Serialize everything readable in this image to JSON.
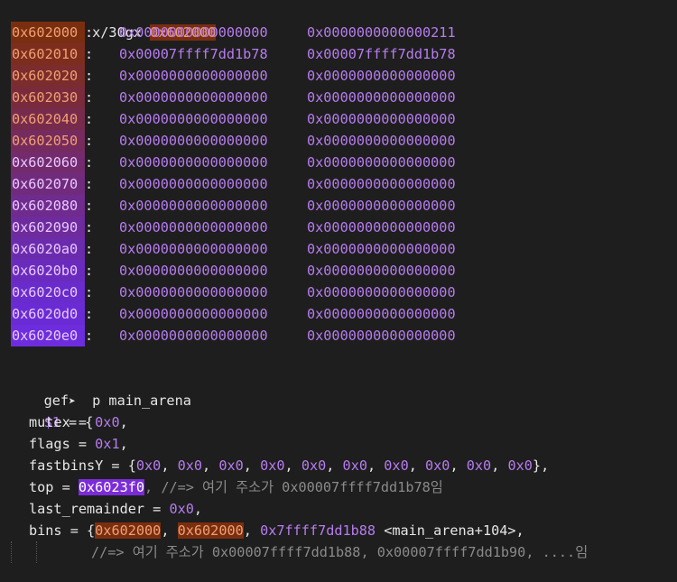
{
  "prompt": {
    "name": "gef",
    "arrow": "➤",
    "cmd1": "x/30gx ",
    "cmd1_arg": "0x602000",
    "cmd2": "p main_arena"
  },
  "memory_rows": [
    {
      "addr": "0x602000",
      "v1": "0x0000000000000000",
      "v2": "0x0000000000000211",
      "color": "#7a2e10"
    },
    {
      "addr": "0x602010",
      "v1": "0x00007ffff7dd1b78",
      "v2": "0x00007ffff7dd1b78",
      "color": "#7c2d1e"
    },
    {
      "addr": "0x602020",
      "v1": "0x0000000000000000",
      "v2": "0x0000000000000000",
      "color": "#7b2c2c"
    },
    {
      "addr": "0x602030",
      "v1": "0x0000000000000000",
      "v2": "0x0000000000000000",
      "color": "#792b3c"
    },
    {
      "addr": "0x602040",
      "v1": "0x0000000000000000",
      "v2": "0x0000000000000000",
      "color": "#772b4c"
    },
    {
      "addr": "0x602050",
      "v1": "0x0000000000000000",
      "v2": "0x0000000000000000",
      "color": "#752b5d"
    },
    {
      "addr": "0x602060",
      "v1": "0x0000000000000000",
      "v2": "0x0000000000000000",
      "color": "#732b6d"
    },
    {
      "addr": "0x602070",
      "v1": "0x0000000000000000",
      "v2": "0x0000000000000000",
      "color": "#712b7d"
    },
    {
      "addr": "0x602080",
      "v1": "0x0000000000000000",
      "v2": "0x0000000000000000",
      "color": "#6f2b8d"
    },
    {
      "addr": "0x602090",
      "v1": "0x0000000000000000",
      "v2": "0x0000000000000000",
      "color": "#6d2b9d"
    },
    {
      "addr": "0x6020a0",
      "v1": "0x0000000000000000",
      "v2": "0x0000000000000000",
      "color": "#6b2bad"
    },
    {
      "addr": "0x6020b0",
      "v1": "0x0000000000000000",
      "v2": "0x0000000000000000",
      "color": "#6a2bbd"
    },
    {
      "addr": "0x6020c0",
      "v1": "0x0000000000000000",
      "v2": "0x0000000000000000",
      "color": "#692bcb"
    },
    {
      "addr": "0x6020d0",
      "v1": "0x0000000000000000",
      "v2": "0x0000000000000000",
      "color": "#6a2bd5"
    },
    {
      "addr": "0x6020e0",
      "v1": "0x0000000000000000",
      "v2": "0x0000000000000000",
      "color": "#6d2ddd"
    }
  ],
  "print": {
    "result_var": "$1",
    "result_op": " = {",
    "mutex_label": "mutex = ",
    "mutex_val": "0x0",
    "flags_label": "flags = ",
    "flags_val": "0x1",
    "fastbins_label": "fastbinsY = {",
    "fastbins": [
      "0x0",
      "0x0",
      "0x0",
      "0x0",
      "0x0",
      "0x0",
      "0x0",
      "0x0",
      "0x0",
      "0x0"
    ],
    "fastbins_end": "},",
    "top_label": "top = ",
    "top_val": "0x6023f0",
    "top_comment": ", //=> 여기 주소가 0x00007ffff7dd1b78임",
    "last_remainder_label": "last_remainder = ",
    "last_remainder_val": "0x0",
    "bins_label": "bins = {",
    "bins_val1": "0x602000",
    "bins_val2": "0x602000",
    "bins_val3": "0x7ffff7dd1b88",
    "bins_sym": " <main_arena+104>,",
    "bins_comment": "//=> 여기 주소가 0x00007ffff7dd1b88, 0x00007ffff7dd1b90, ....임"
  }
}
